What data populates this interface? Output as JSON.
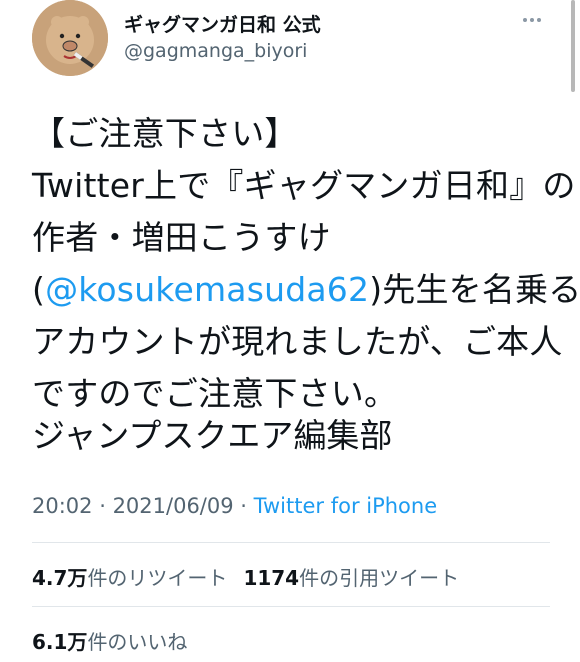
{
  "account": {
    "display_name": "ギャグマンガ日和 公式",
    "handle": "@gagmanga_biyori"
  },
  "tweet": {
    "lines": [
      "【ご注意下さい】",
      "Twitter上で『ギャグマンガ日和』の",
      "作者・増田こうすけ"
    ],
    "mention_prefix": "(",
    "mention": "@kosukemasuda62",
    "mention_suffix": ")先生を名乗る",
    "line5": "アカウントが現れましたが、ご本人",
    "line6": "ですのでご注意下さい。",
    "signature": "ジャンプスクエア編集部"
  },
  "meta": {
    "time": "20:02",
    "separator1": " · ",
    "date": "2021/06/09",
    "separator2": " · ",
    "source": "Twitter for iPhone"
  },
  "stats": {
    "retweets_count": "4.7万",
    "retweets_label": "件のリツイート",
    "quotes_count": "1174",
    "quotes_label": "件の引用ツイート",
    "likes_count": "6.1万",
    "likes_label": "件のいいね"
  },
  "icons": {
    "more": "more-dots-icon"
  }
}
